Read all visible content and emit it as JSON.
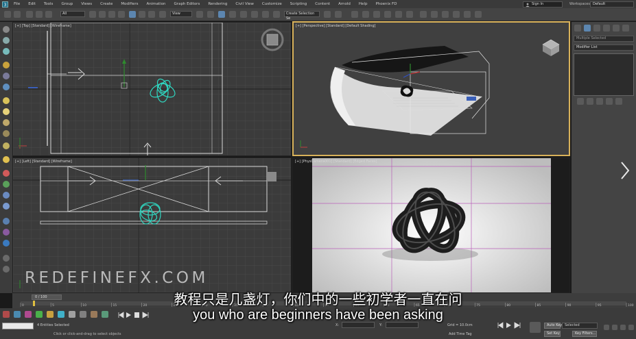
{
  "menubar": {
    "items": [
      "File",
      "Edit",
      "Tools",
      "Group",
      "Views",
      "Create",
      "Modifiers",
      "Animation",
      "Graph Editors",
      "Rendering",
      "Civil View",
      "Customize",
      "Scripting",
      "Content",
      "Arnold",
      "Help",
      "Phoenix FD"
    ],
    "sign_in": "Sign In",
    "workspaces_label": "Workspaces:",
    "workspaces_value": "Default"
  },
  "toolbar": {
    "filter_value": "All",
    "refcoord_value": "View",
    "selection_set_placeholder": "Create Selection Se"
  },
  "viewports": {
    "top_label": "[+] [Top] [Standard] [Wireframe]",
    "perspective_label": "[+] [Perspective] [Standard] [Default Shading]",
    "left_label": "[+] [Left] [Standard] [Wireframe]",
    "camera_label": "[+] [PhysCamera001] [Standard] [Edged Faces]"
  },
  "command_panel": {
    "object_name_placeholder": "Multiple Selected",
    "modifier_list": "Modifier List"
  },
  "timeline": {
    "frame_counter": "0 / 100",
    "ruler_ticks": [
      "0",
      "5",
      "10",
      "15",
      "20",
      "25",
      "30",
      "35",
      "40",
      "45",
      "50",
      "55",
      "60",
      "65",
      "70",
      "75",
      "80",
      "85",
      "90",
      "95",
      "100"
    ]
  },
  "statusbar": {
    "selected_text": "4 Entities Selected",
    "hint_text": "Click or click-and-drag to select objects",
    "x_label": "X:",
    "y_label": "Y:",
    "grid_text": "Grid = 10.0cm",
    "add_time_tag": "Add Time Tag",
    "auto_key": "Auto Key",
    "selected_dropdown": "Selected",
    "set_key": "Set Key",
    "key_filters": "Key Filters..."
  },
  "watermark": "REDEFINEFX.COM",
  "subtitles": {
    "zh": "教程只是几盏灯，你们中的一些初学者一直在问",
    "en": "you who are beginners have been asking"
  },
  "colors": {
    "viewport_active_border": "#d9b25a",
    "wire_teal": "#2fd6c0",
    "camera_grid": "#b95fb9"
  }
}
